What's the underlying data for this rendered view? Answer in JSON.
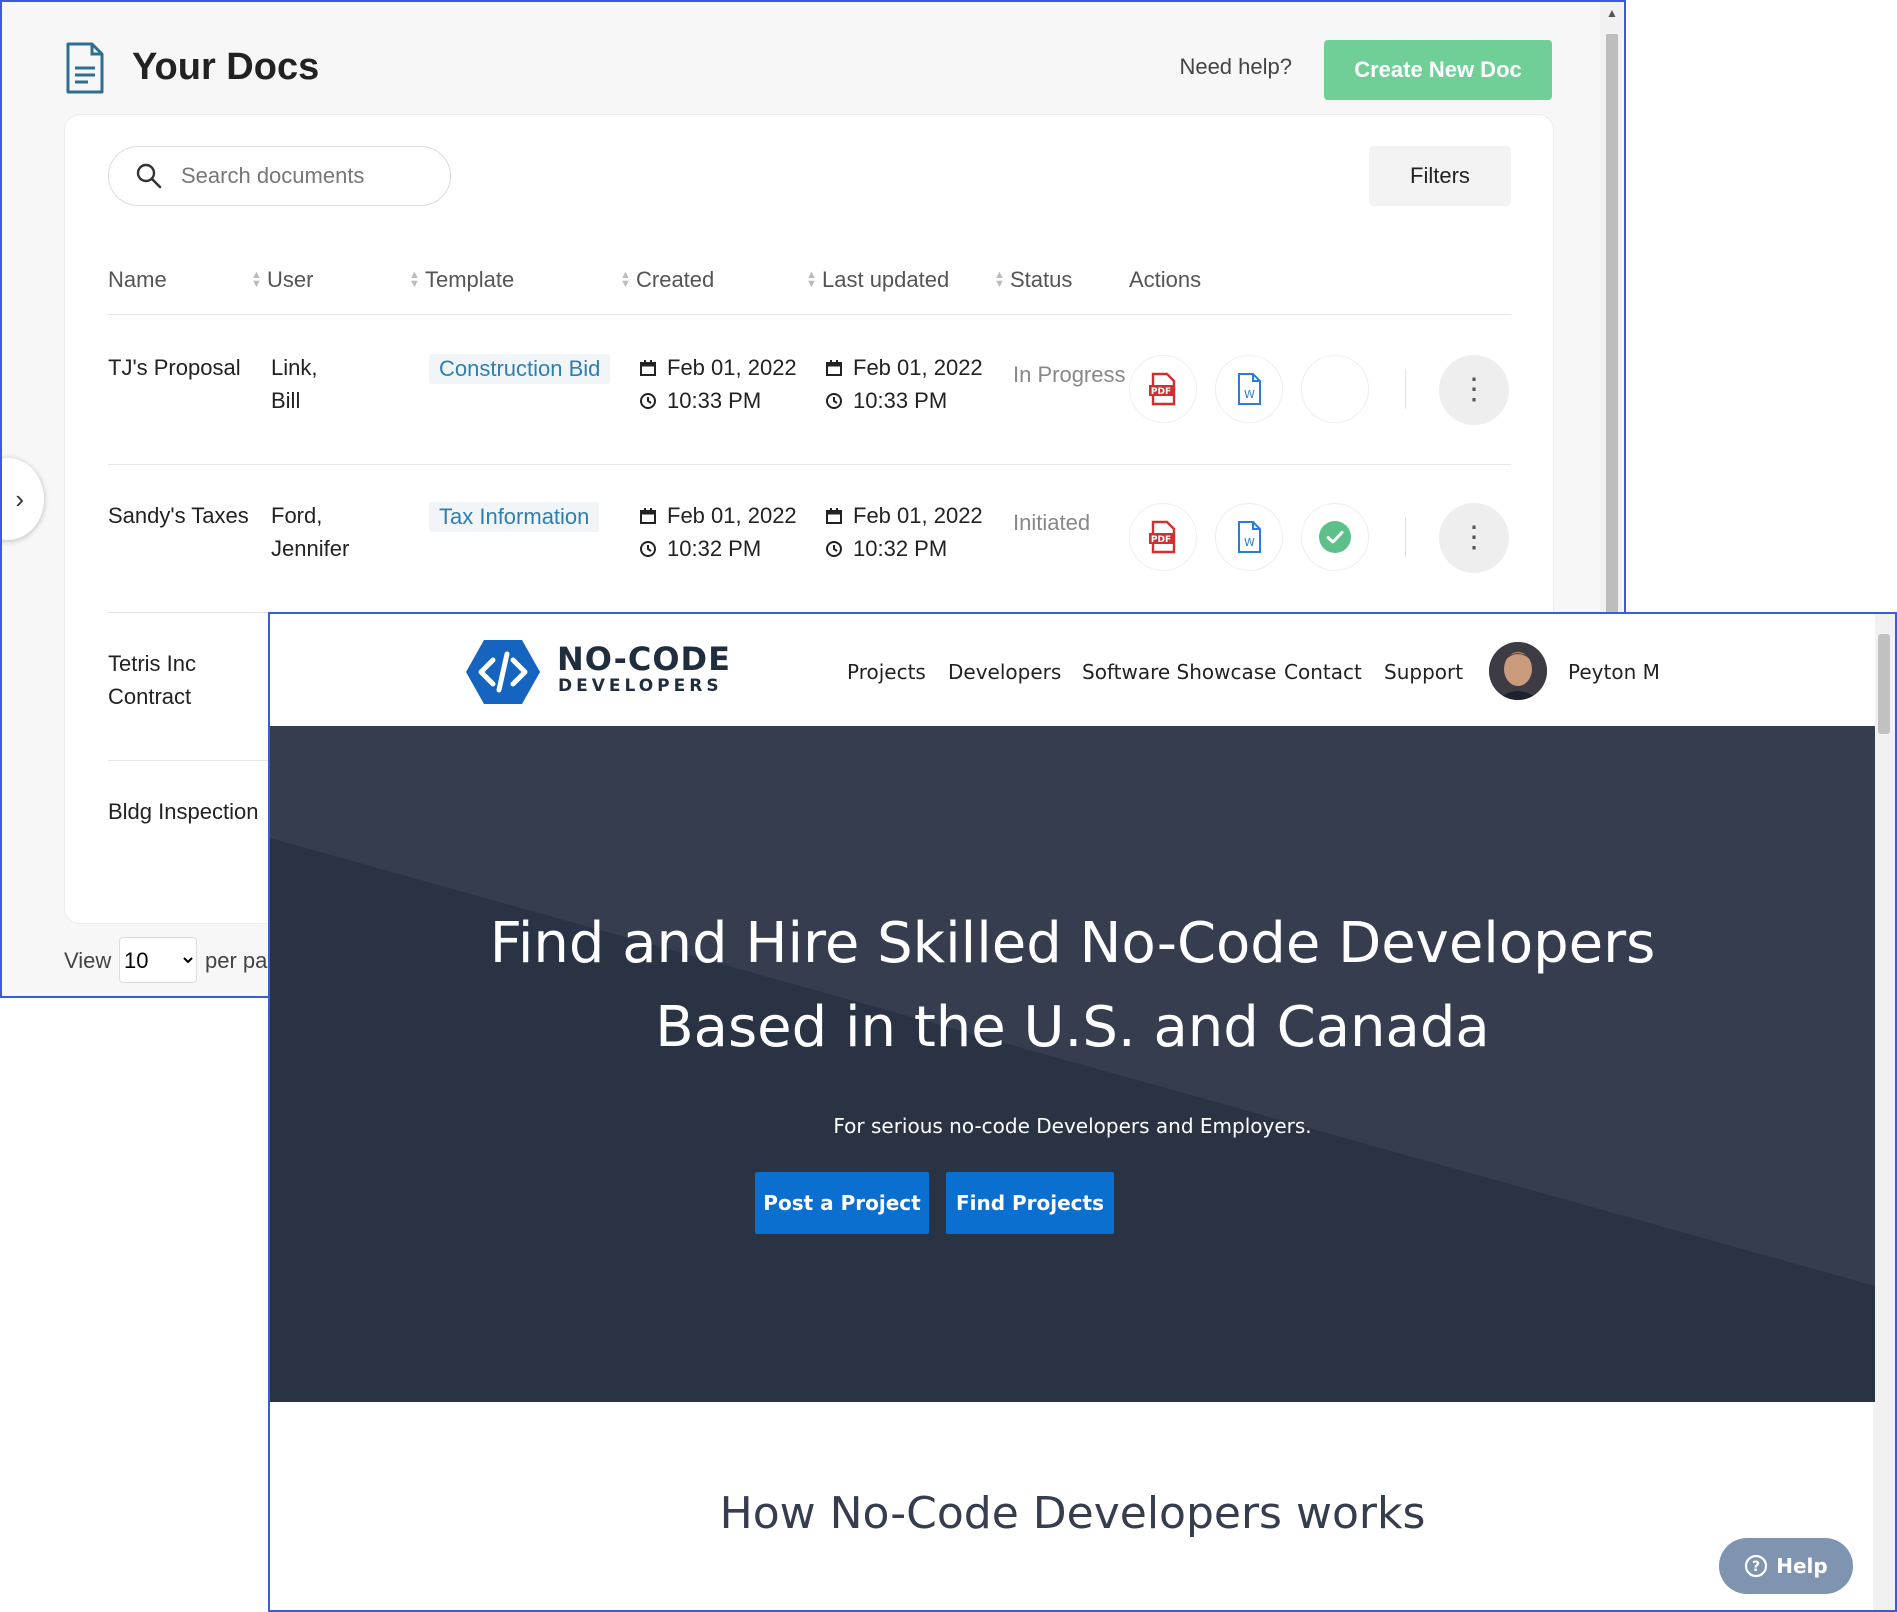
{
  "docs_app": {
    "title": "Your Docs",
    "need_help": "Need help?",
    "create_button": "Create New Doc",
    "search_placeholder": "Search documents",
    "filters_button": "Filters",
    "columns": [
      "Name",
      "User",
      "Template",
      "Created",
      "Last updated",
      "Status",
      "Actions"
    ],
    "rows": [
      {
        "name": "TJ's Proposal",
        "user_line1": "Link,",
        "user_line2": "Bill",
        "template": "Construction Bid",
        "created_date": "Feb 01, 2022",
        "created_time": "10:33 PM",
        "updated_date": "Feb 01, 2022",
        "updated_time": "10:33 PM",
        "status": "In Progress",
        "signed": false
      },
      {
        "name": "Sandy's Taxes",
        "user_line1": "Ford,",
        "user_line2": "Jennifer",
        "template": "Tax Information",
        "created_date": "Feb 01, 2022",
        "created_time": "10:32 PM",
        "updated_date": "Feb 01, 2022",
        "updated_time": "10:32 PM",
        "status": "Initiated",
        "signed": true
      },
      {
        "name_line1": "Tetris Inc",
        "name_line2": "Contract"
      },
      {
        "name": "Bldg Inspection"
      }
    ],
    "pagination": {
      "view_label": "View",
      "per_page_value": "10",
      "per_page_label": "per page"
    },
    "colors": {
      "accent": "#6fcf97",
      "template_text": "#2e7fb0",
      "pdf_red": "#d32f2f",
      "word_blue": "#2b7cd3",
      "check_green": "#5cc08a"
    }
  },
  "ncd_site": {
    "brand_line1": "NO-CODE",
    "brand_line2": "DEVELOPERS",
    "nav": [
      "Projects",
      "Developers",
      "Software Showcase",
      "Contact",
      "Support"
    ],
    "user_name": "Peyton M",
    "hero_title_line1": "Find and Hire Skilled No-Code Developers",
    "hero_title_line2": "Based in the U.S. and Canada",
    "hero_subtitle": "For serious no-code Developers and Employers.",
    "btn_post": "Post a Project",
    "btn_find": "Find Projects",
    "section_title": "How No-Code Developers works",
    "help_label": "Help",
    "colors": {
      "hero_bg": "#353d4f",
      "hero_shape": "#2a3344",
      "button_blue": "#0b6fd0",
      "logo_blue": "#1565c0"
    }
  }
}
